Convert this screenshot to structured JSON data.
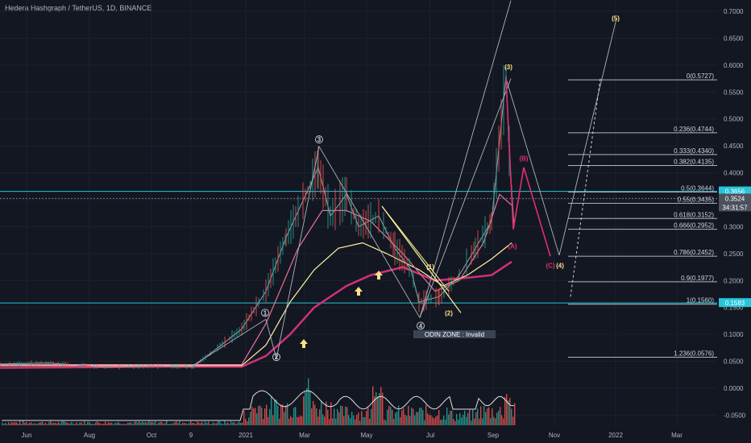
{
  "header": {
    "symbol": "Hedera Hashgraph / TetherUS, 1D, BINANCE"
  },
  "colors": {
    "bg": "#131722",
    "grid": "#1e222d",
    "price": "#9aa0a6",
    "fib": "#b2b5be",
    "cyan": "#26c6da",
    "wave_red": "#e0306a",
    "wave_yellow": "#ffe082",
    "ma_yellow": "#fff59d",
    "ma_magenta": "#d0307a",
    "ma_pink": "#e57399",
    "vol_up": "#26a69a",
    "vol_down": "#ef5350"
  },
  "chart_data": {
    "type": "line",
    "price_axis": {
      "ticks": [
        "0.7000",
        "0.6500",
        "0.6000",
        "0.5500",
        "0.5000",
        "0.4500",
        "0.4000",
        "0.3500",
        "0.3000",
        "0.2500",
        "0.2000",
        "0.1500",
        "0.1000",
        "0.0500",
        "0.0000",
        "-0.0500"
      ]
    },
    "time_axis": {
      "ticks": [
        "Jun",
        "Aug",
        "Oct",
        "9",
        "2021",
        "Mar",
        "May",
        "Jul",
        "Sep",
        "Nov",
        "2022",
        "Mar"
      ]
    },
    "price_tags": [
      {
        "value": "0.3656",
        "color": "#26c6da"
      },
      {
        "value": "0.3524",
        "color": "#4c525e"
      },
      {
        "value": "34:31:57",
        "color": "#4c525e"
      },
      {
        "value": "0.1583",
        "color": "#26c6da"
      }
    ],
    "horizontal_levels": [
      0.3656,
      0.1583
    ],
    "fib_levels": [
      {
        "ratio": "0",
        "price": 0.5727,
        "label": "0(0.5727)"
      },
      {
        "ratio": "0.236",
        "price": 0.4744,
        "label": "0.236(0.4744)"
      },
      {
        "ratio": "0.333",
        "price": 0.434,
        "label": "0.333(0.4340)"
      },
      {
        "ratio": "0.382",
        "price": 0.4135,
        "label": "0.382(0.4135)"
      },
      {
        "ratio": "0.5",
        "price": 0.3644,
        "label": "0.5(0.3644)"
      },
      {
        "ratio": "0.55",
        "price": 0.3435,
        "label": "0.55(0.3435)"
      },
      {
        "ratio": "0.618",
        "price": 0.3152,
        "label": "0.618(0.3152)"
      },
      {
        "ratio": "0.666",
        "price": 0.2952,
        "label": "0.666(0.2952)"
      },
      {
        "ratio": "0.786",
        "price": 0.2452,
        "label": "0.786(0.2452)"
      },
      {
        "ratio": "0.9",
        "price": 0.1977,
        "label": "0.9(0.1977)"
      },
      {
        "ratio": "1",
        "price": 0.156,
        "label": "1(0.1560)"
      },
      {
        "ratio": "1.236",
        "price": 0.0576,
        "label": "1.236(0.0576)"
      }
    ],
    "price_series": [
      [
        "Jun",
        0.045
      ],
      [
        "Aug",
        0.047
      ],
      [
        "Oct",
        0.039
      ],
      [
        "9",
        0.041
      ],
      [
        "2021",
        0.04
      ],
      [
        "2021",
        0.11
      ],
      [
        "Feb",
        0.18
      ],
      [
        "Feb",
        0.28
      ],
      [
        "Mar",
        0.41
      ],
      [
        "Mar",
        0.32
      ],
      [
        "Apr",
        0.36
      ],
      [
        "Apr",
        0.3
      ],
      [
        "May",
        0.32
      ],
      [
        "May",
        0.26
      ],
      [
        "Jun",
        0.22
      ],
      [
        "Jun",
        0.16
      ],
      [
        "Jul",
        0.17
      ],
      [
        "Jul",
        0.21
      ],
      [
        "Aug",
        0.26
      ],
      [
        "Aug",
        0.31
      ],
      [
        "Sep",
        0.58
      ],
      [
        "Sep",
        0.44
      ],
      [
        "Sep",
        0.3
      ]
    ],
    "waves": [
      {
        "label": "1",
        "price": 0.128,
        "time": "2021"
      },
      {
        "label": "2",
        "price": 0.055,
        "time": "2021"
      },
      {
        "label": "3",
        "price": 0.449,
        "time": "Mar"
      },
      {
        "label": "4",
        "price": 0.131,
        "time": "Jul"
      },
      {
        "label": "(1)",
        "price": 0.226,
        "time": "Jul"
      },
      {
        "label": "(2)",
        "price": 0.162,
        "time": "Jul"
      },
      {
        "label": "(3)",
        "price": 0.59,
        "time": "Sep"
      },
      {
        "label": "(A)",
        "price": 0.26,
        "time": "Sep"
      },
      {
        "label": "(B)",
        "price": 0.425,
        "time": "Sep"
      },
      {
        "label": "(C)",
        "price": 0.227,
        "time": "Nov"
      },
      {
        "label": "(4)",
        "price": 0.227,
        "time": "Nov"
      },
      {
        "label": "(5)",
        "price": 0.686,
        "time": "2022"
      }
    ],
    "annotation": "ODIN ZONE : Invalid"
  }
}
